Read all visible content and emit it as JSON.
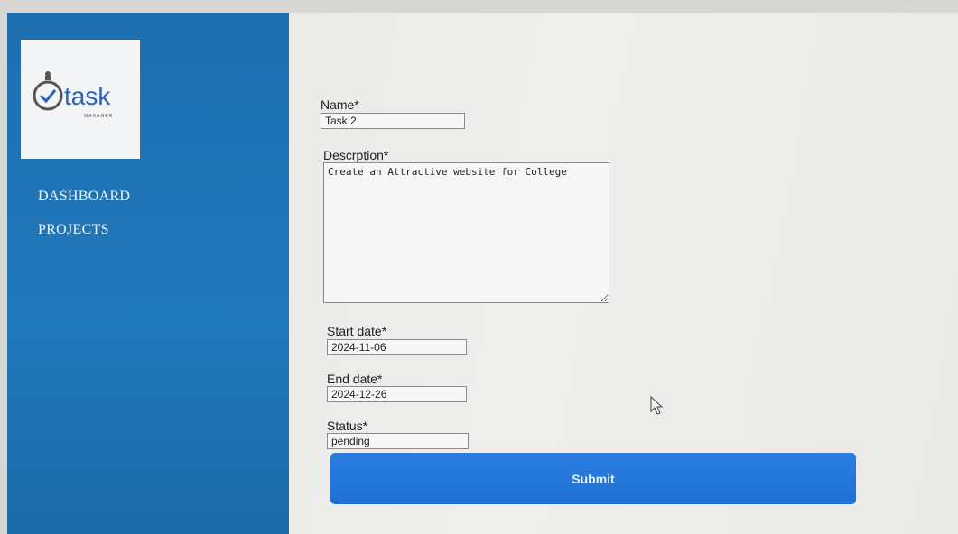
{
  "sidebar": {
    "logo_text": "task",
    "logo_subtext": "MANAGER",
    "items": [
      {
        "label": "DASHBOARD"
      },
      {
        "label": "PROJECTS"
      }
    ]
  },
  "form": {
    "name": {
      "label": "Name*",
      "value": "Task 2"
    },
    "description": {
      "label": "Descrption*",
      "value": "Create an Attractive website for College"
    },
    "start_date": {
      "label": "Start date*",
      "value": "2024-11-06"
    },
    "end_date": {
      "label": "End date*",
      "value": "2024-12-26"
    },
    "status": {
      "label": "Status*",
      "value": "pending"
    },
    "submit_label": "Submit"
  },
  "colors": {
    "sidebar": "#2178b9",
    "submit": "#1f6fd4",
    "logo_ink": "#2a63b5"
  },
  "icons": [
    "stopwatch-icon",
    "mouse-pointer-icon"
  ]
}
